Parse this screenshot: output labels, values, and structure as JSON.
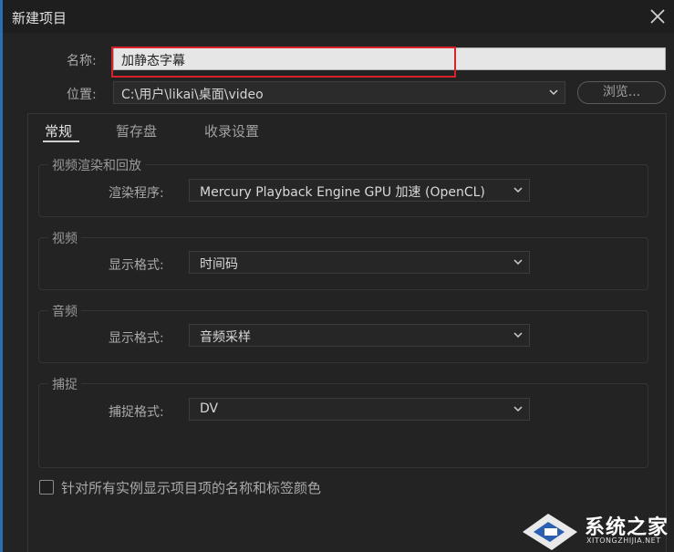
{
  "window": {
    "title": "新建项目"
  },
  "form": {
    "name_label": "名称:",
    "name_value": "加静态字幕",
    "location_label": "位置:",
    "location_value": "C:\\用户\\likai\\桌面\\video",
    "browse_label": "浏览..."
  },
  "tabs": [
    {
      "label": "常规",
      "active": true
    },
    {
      "label": "暂存盘",
      "active": false
    },
    {
      "label": "收录设置",
      "active": false
    }
  ],
  "groups": {
    "video_render": {
      "title": "视频渲染和回放",
      "renderer_label": "渲染程序:",
      "renderer_value": "Mercury Playback Engine GPU 加速 (OpenCL)"
    },
    "video": {
      "title": "视频",
      "format_label": "显示格式:",
      "format_value": "时间码"
    },
    "audio": {
      "title": "音频",
      "format_label": "显示格式:",
      "format_value": "音频采样"
    },
    "capture": {
      "title": "捕捉",
      "format_label": "捕捉格式:",
      "format_value": "DV"
    }
  },
  "checkbox": {
    "label": "针对所有实例显示项目项的名称和标签颜色",
    "checked": false
  },
  "watermark": {
    "brand": "系统之家",
    "url": "XITONGZHIJIA.NET"
  },
  "colors": {
    "highlight": "#d8222a",
    "accent_border": "#2a6fb5"
  }
}
